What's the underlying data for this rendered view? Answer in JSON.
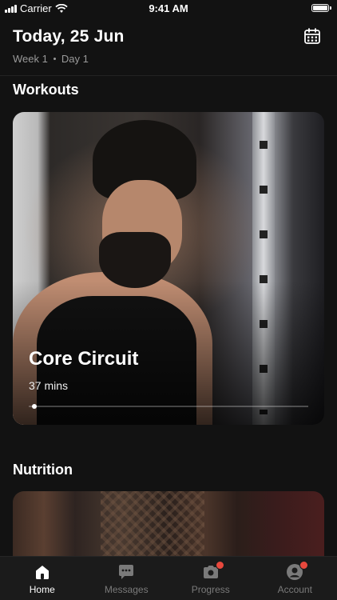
{
  "status_bar": {
    "carrier": "Carrier",
    "time": "9:41 AM"
  },
  "header": {
    "title": "Today, 25 Jun",
    "week": "Week 1",
    "day": "Day 1",
    "calendar_icon": "calendar-icon"
  },
  "workouts": {
    "section_title": "Workouts",
    "card": {
      "name": "Core Circuit",
      "duration": "37 mins",
      "progress": 0.02
    }
  },
  "nutrition": {
    "section_title": "Nutrition"
  },
  "tabbar": {
    "tabs": [
      {
        "label": "Home",
        "icon": "home-icon",
        "active": true,
        "badge": false
      },
      {
        "label": "Messages",
        "icon": "messages-icon",
        "active": false,
        "badge": false
      },
      {
        "label": "Progress",
        "icon": "camera-icon",
        "active": false,
        "badge": true
      },
      {
        "label": "Account",
        "icon": "account-icon",
        "active": false,
        "badge": true
      }
    ]
  },
  "colors": {
    "background": "#121212",
    "badge": "#e8483d",
    "inactive": "#7a7a7a"
  }
}
